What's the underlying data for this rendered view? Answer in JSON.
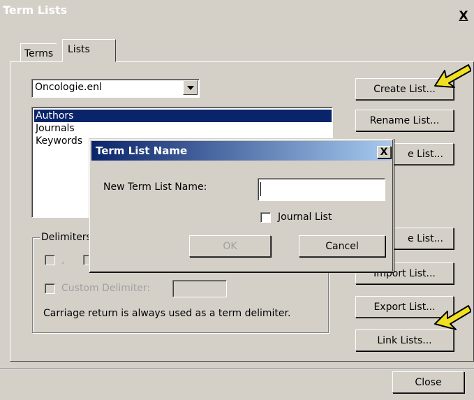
{
  "window": {
    "title": "Term Lists",
    "close_label": "X"
  },
  "tabs": [
    {
      "label": "Terms"
    },
    {
      "label": "Lists"
    }
  ],
  "library_select": {
    "value": "Oncologie.enl"
  },
  "lists": [
    {
      "label": "Authors",
      "selected": true
    },
    {
      "label": "Journals"
    },
    {
      "label": "Keywords"
    }
  ],
  "buttons": {
    "create": "Create List...",
    "rename": "Rename List...",
    "delete": "e List...",
    "delete_full": "Delete List...",
    "update": "e List...",
    "update_full": "Update List...",
    "import": "Import List...",
    "export": "Export List...",
    "link": "Link Lists...",
    "close": "Close"
  },
  "delimiters": {
    "legend": "Delimiters",
    "comma_label": ",",
    "custom_label": "Custom Delimiter:",
    "custom_value": "",
    "note": "Carriage return is always used as a term delimiter."
  },
  "dialog": {
    "title": "Term List Name",
    "close_label": "X",
    "field_label": "New Term List Name:",
    "field_value": "",
    "journal_checkbox_label": "Journal List",
    "journal_checked": false,
    "ok_label": "OK",
    "cancel_label": "Cancel"
  },
  "colors": {
    "selection": "#0a246a",
    "annotation_arrow": "#f0e020"
  },
  "icons": {
    "dropdown": "chevron-down-icon",
    "annotation": "arrow-annotation-icon"
  }
}
